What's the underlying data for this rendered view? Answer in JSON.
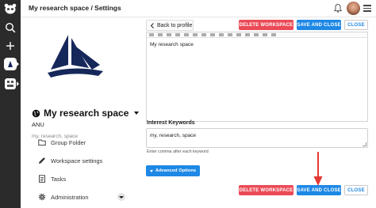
{
  "topbar": {
    "breadcrumb": "My research space / Settings"
  },
  "sidebar": {
    "space_name": "My research space",
    "org": "ANU",
    "keywords": "my, research, space",
    "nav": [
      {
        "label": "Group Folder",
        "icon": "folder-icon"
      },
      {
        "label": "Workspace settings",
        "icon": "pencil-icon"
      },
      {
        "label": "Tasks",
        "icon": "checklist-icon"
      },
      {
        "label": "Administration",
        "icon": "gear-icon"
      }
    ]
  },
  "main": {
    "back_label": "Back to profile",
    "delete_label": "DELETE WORKSPACE",
    "save_label": "SAVE AND CLOSE",
    "close_label": "CLOSE",
    "editor_text": "My research space",
    "interest_label": "Interest Keywords",
    "interest_value": "my, research, space",
    "interest_help": "Enter comma after each keyword",
    "advanced_label": "Advanced Options"
  },
  "colors": {
    "rail": "#2b2b2b",
    "danger": "#ea4a56",
    "primary": "#1e88e5",
    "brand_navy": "#16285a",
    "annotation_arrow": "#e53935"
  }
}
